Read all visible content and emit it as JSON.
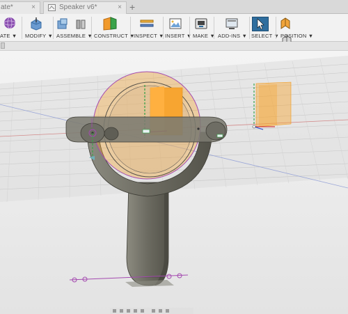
{
  "tabs": [
    {
      "label": "ate*",
      "active": false
    },
    {
      "label": "Speaker v6*",
      "active": false
    }
  ],
  "tab_close_symbol": "×",
  "tab_new_symbol": "+",
  "toolbar": {
    "groups": [
      {
        "label": "ATE ▼",
        "icon": "create-sphere-icon"
      },
      {
        "label": "MODIFY ▼",
        "icon": "modify-push-pull-icon"
      },
      {
        "label": "ASSEMBLE ▼",
        "icon": "assemble-joint-icon"
      },
      {
        "label": "CONSTRUCT ▼",
        "icon": "construct-plane-icon"
      },
      {
        "label": "INSPECT ▼",
        "icon": "inspect-measure-icon"
      },
      {
        "label": "INSERT ▼",
        "icon": "insert-image-icon"
      },
      {
        "label": "MAKE ▼",
        "icon": "make-3d-print-icon"
      },
      {
        "label": "ADD-INS ▼",
        "icon": "add-ins-scripts-icon"
      },
      {
        "label": "SELECT ▼",
        "icon": "select-arrow-icon",
        "active": true
      },
      {
        "label": "POSITION ▼",
        "icon": "position-capture-icon"
      }
    ]
  },
  "colors": {
    "accent_select": "#2f6e9e",
    "body_orange": "#f7a531",
    "part_gray": "#6f6e64",
    "sketch_magenta": "#a44ab0",
    "axis_green": "#3aa34a",
    "axis_red": "#d23a3a",
    "axis_blue": "#3a5bd2"
  }
}
